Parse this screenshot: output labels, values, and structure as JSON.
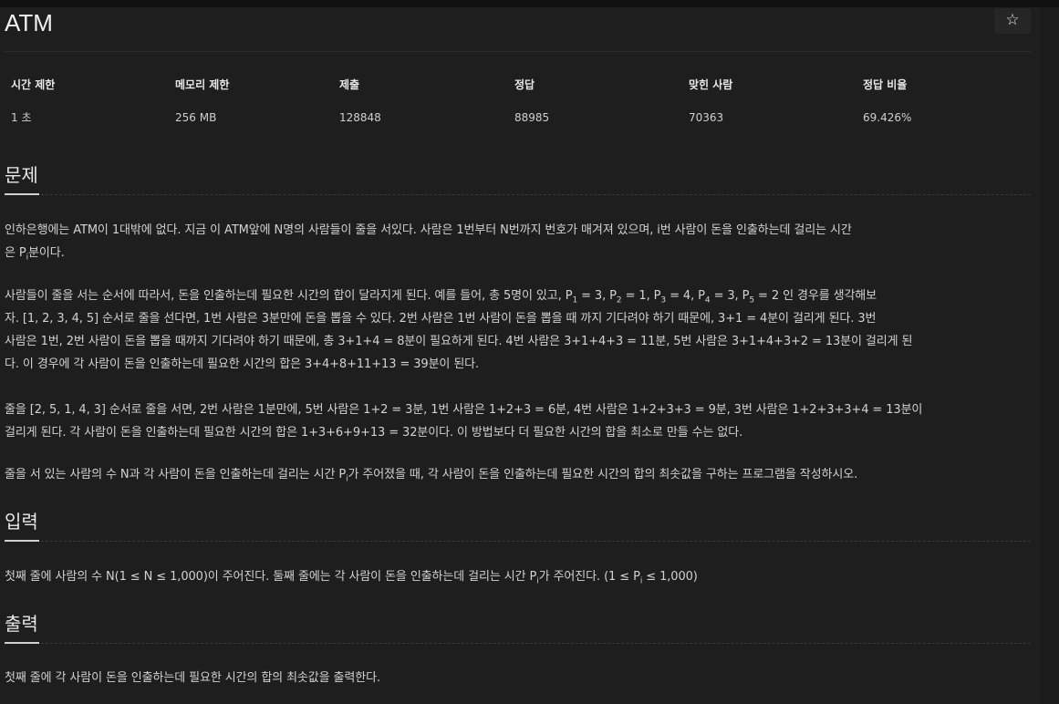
{
  "problem": {
    "title": "ATM",
    "star_icon": "☆"
  },
  "stats": {
    "headers": [
      "시간 제한",
      "메모리 제한",
      "제출",
      "정답",
      "맞힌 사람",
      "정답 비율"
    ],
    "values": [
      "1 초",
      "256 MB",
      "128848",
      "88985",
      "70363",
      "69.426%"
    ]
  },
  "sections": {
    "description": {
      "heading": "문제",
      "p1_line1": "인하은행에는 ATM이 1대밖에 없다. 지금 이 ATM앞에 N명의 사람들이 줄을 서있다. 사람은 1번부터 N번까지 번호가 매겨져 있으며, i번 사람이 돈을 인출하는데 걸리는 시간",
      "p1_line2_pre": "은 P",
      "p1_line2_sub": "i",
      "p1_line2_post": "분이다.",
      "p2_line1_pre": "사람들이 줄을 서는 순서에 따라서, 돈을 인출하는데 필요한 시간의 합이 달라지게 된다. 예를 들어, 총 5명이 있고, P",
      "p2_sub1": "1",
      "p2_mid1": " = 3, P",
      "p2_sub2": "2",
      "p2_mid2": " = 1, P",
      "p2_sub3": "3",
      "p2_mid3": " = 4, P",
      "p2_sub4": "4",
      "p2_mid4": " = 3, P",
      "p2_sub5": "5",
      "p2_line1_post": " = 2 인 경우를 생각해보",
      "p2_line2": "자. [1, 2, 3, 4, 5] 순서로 줄을 선다면, 1번 사람은 3분만에 돈을 뽑을 수 있다. 2번 사람은 1번 사람이 돈을 뽑을 때 까지 기다려야 하기 때문에, 3+1 = 4분이 걸리게 된다. 3번",
      "p2_line3": "사람은 1번, 2번 사람이 돈을 뽑을 때까지 기다려야 하기 때문에, 총 3+1+4 = 8분이 필요하게 된다. 4번 사람은 3+1+4+3 = 11분, 5번 사람은 3+1+4+3+2 = 13분이 걸리게 된",
      "p2_line4": "다. 이 경우에 각 사람이 돈을 인출하는데 필요한 시간의 합은 3+4+8+11+13 = 39분이 된다.",
      "p3_line1": "줄을 [2, 5, 1, 4, 3] 순서로 줄을 서면, 2번 사람은 1분만에, 5번 사람은 1+2 = 3분, 1번 사람은 1+2+3 = 6분, 4번 사람은 1+2+3+3 = 9분, 3번 사람은 1+2+3+3+4 = 13분이",
      "p3_line2": "걸리게 된다. 각 사람이 돈을 인출하는데 필요한 시간의 합은 1+3+6+9+13 = 32분이다. 이 방법보다 더 필요한 시간의 합을 최소로 만들 수는 없다.",
      "p4_pre": "줄을 서 있는 사람의 수 N과 각 사람이 돈을 인출하는데 걸리는 시간 P",
      "p4_sub": "i",
      "p4_post": "가 주어졌을 때, 각 사람이 돈을 인출하는데 필요한 시간의 합의 최솟값을 구하는 프로그램을 작성하시오."
    },
    "input": {
      "heading": "입력",
      "text_pre": "첫째 줄에 사람의 수 N(1 ≤ N ≤ 1,000)이 주어진다. 둘째 줄에는 각 사람이 돈을 인출하는데 걸리는 시간 P",
      "text_sub1": "i",
      "text_mid": "가 주어진다. (1 ≤ P",
      "text_sub2": "i",
      "text_post": " ≤ 1,000)"
    },
    "output": {
      "heading": "출력",
      "text": "첫째 줄에 각 사람이 돈을 인출하는데 필요한 시간의 합의 최솟값을 출력한다."
    }
  }
}
